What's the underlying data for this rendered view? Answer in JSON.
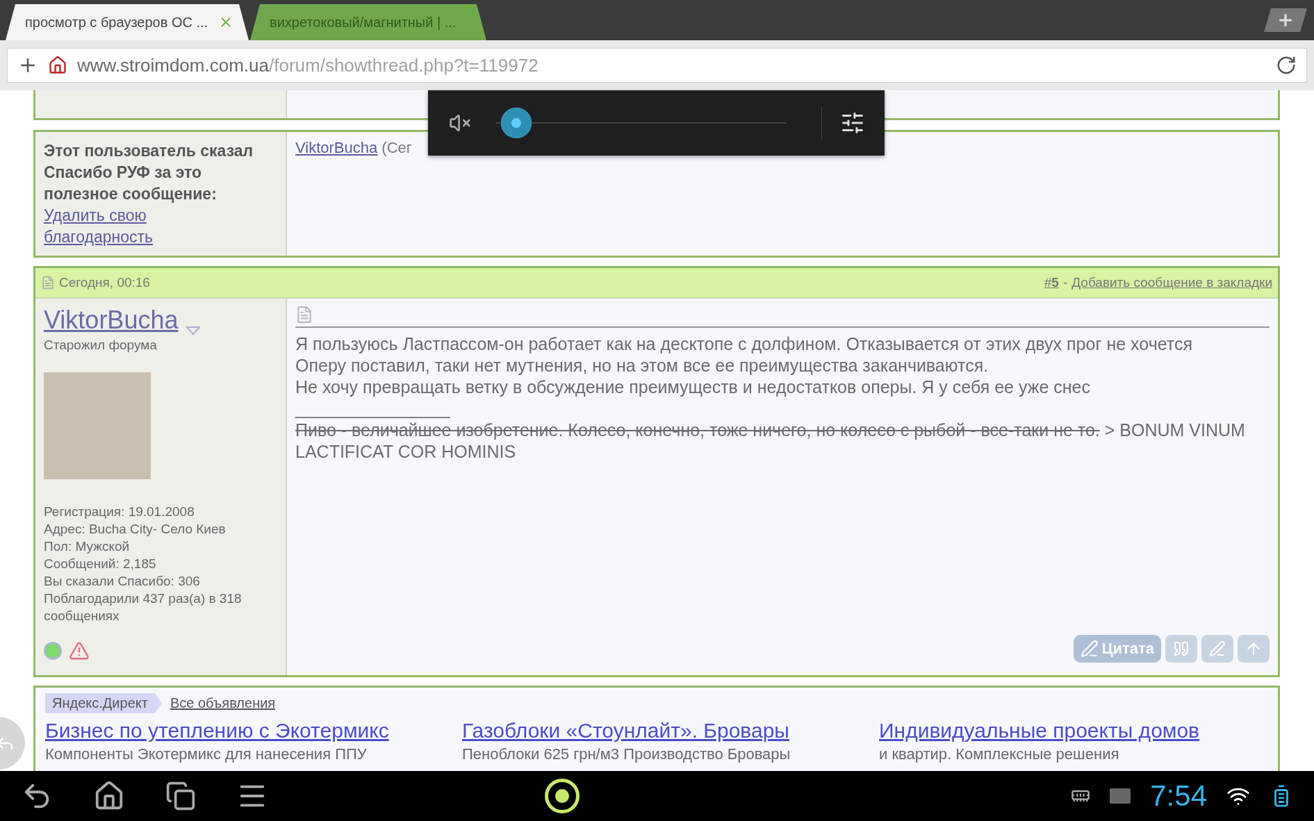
{
  "browser": {
    "tabs": [
      {
        "title": "просмотр с браузеров ОС ...",
        "selected": true
      },
      {
        "title": "вихретоковый/магнитный | ...",
        "selected": false
      }
    ],
    "url_host": "www.stroimdom.com.ua",
    "url_path": "/forum/showthread.php?t=119972"
  },
  "volume_popup": {
    "muted": true,
    "level": 0.02
  },
  "thanks": {
    "label": "Этот пользователь сказал Спасибо РУФ за это полезное сообщение:",
    "remove_link": "Удалить свою благодарность",
    "users": [
      {
        "name": "ViktorBucha",
        "note": "(Сег"
      }
    ]
  },
  "post": {
    "date": "Сегодня, 00:16",
    "number": "#**5**",
    "separator": "-",
    "bookmark": "Добавить сообщение в закладки",
    "author": {
      "name": "ViktorBucha",
      "title": "Старожил форума",
      "online": true,
      "stats": [
        "Регистрация: 19.01.2008",
        "Адрес: Bucha City- Село Киев",
        "Пол: Мужской",
        "Сообщений: 2,185",
        "Вы сказали Спасибо: 306",
        "Поблагодарили 437 раз(а) в 318 сообщениях"
      ]
    },
    "body": [
      "Я пользуюсь Ластпассом-он работает как на десктопе с долфином. Отказывается от этих двух прог не хочется",
      "Оперу поставил, таки нет мутнения, но на этом все ее преимущества заканчиваются.",
      "Не хочу превращать ветку в обсуждение преимуществ и недостатков оперы. Я у себя ее уже снес"
    ],
    "signature_rule": "________________",
    "signature_struck": "Пиво - величайшее изобретение. Колесо, конечно, тоже ничего, но колесо с рыбой - все-таки не то.",
    "signature_rest": "> BONUM VINUM LACTIFICAT COR HOMINIS",
    "quote_button": "Цитата"
  },
  "ads": {
    "label": "Яндекс.Директ",
    "all_link": "Все объявления",
    "items": [
      {
        "title": "Бизнес по утеплению с Экотермикс",
        "text": "Компоненты Экотермикс для нанесения ППУ"
      },
      {
        "title": "Газоблоки «Стоунлайт». Бровары",
        "text": "Пеноблоки 625 грн/м3 Производство Бровары"
      },
      {
        "title": "Индивидуальные проекты домов",
        "text": "и квартир. Комплексные решения"
      }
    ]
  },
  "system_bar": {
    "time": "7:54"
  }
}
